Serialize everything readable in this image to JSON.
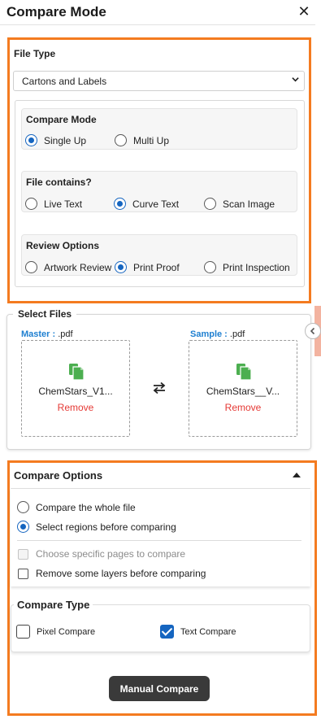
{
  "header": {
    "title": "Compare Mode",
    "close_glyph": "✕"
  },
  "file_type": {
    "label": "File Type",
    "selected": "Cartons and Labels",
    "compare_mode": {
      "title": "Compare Mode",
      "options": [
        {
          "label": "Single Up",
          "checked": true
        },
        {
          "label": "Multi Up",
          "checked": false
        }
      ]
    },
    "file_contains": {
      "title": "File contains?",
      "options": [
        {
          "label": "Live Text",
          "checked": false
        },
        {
          "label": "Curve Text",
          "checked": true
        },
        {
          "label": "Scan Image",
          "checked": false
        }
      ]
    },
    "review_options": {
      "title": "Review Options",
      "options": [
        {
          "label": "Artwork Review",
          "checked": false
        },
        {
          "label": "Print Proof",
          "checked": true
        },
        {
          "label": "Print Inspection",
          "checked": false
        }
      ]
    }
  },
  "select_files": {
    "title": "Select Files",
    "master": {
      "label": "Master :",
      "ext": " .pdf",
      "name": "ChemStars_V1...",
      "remove": "Remove"
    },
    "sample": {
      "label": "Sample :",
      "ext": " .pdf",
      "name": "ChemStars__V...",
      "remove": "Remove"
    }
  },
  "compare_options": {
    "title": "Compare Options",
    "radios": [
      {
        "label": "Compare the whole file",
        "checked": false
      },
      {
        "label": "Select regions before comparing",
        "checked": true
      }
    ],
    "checkboxes": [
      {
        "label": "Choose specific pages to compare",
        "checked": false,
        "disabled": true
      },
      {
        "label": "Remove some layers before comparing",
        "checked": false,
        "disabled": false
      }
    ]
  },
  "compare_type": {
    "title": "Compare Type",
    "options": [
      {
        "label": "Pixel Compare",
        "checked": false
      },
      {
        "label": "Text Compare",
        "checked": true
      }
    ]
  },
  "action": {
    "label": "Manual Compare"
  },
  "colors": {
    "accent": "#1565c0",
    "highlight": "#f47b20",
    "remove": "#e53935",
    "file_icon": "#4caf50",
    "button": "#3a3a3a"
  },
  "icons": [
    "close-icon",
    "chevron-down-icon",
    "file-copy-icon",
    "swap-icon",
    "collapse-caret-icon",
    "chevron-left-icon"
  ]
}
